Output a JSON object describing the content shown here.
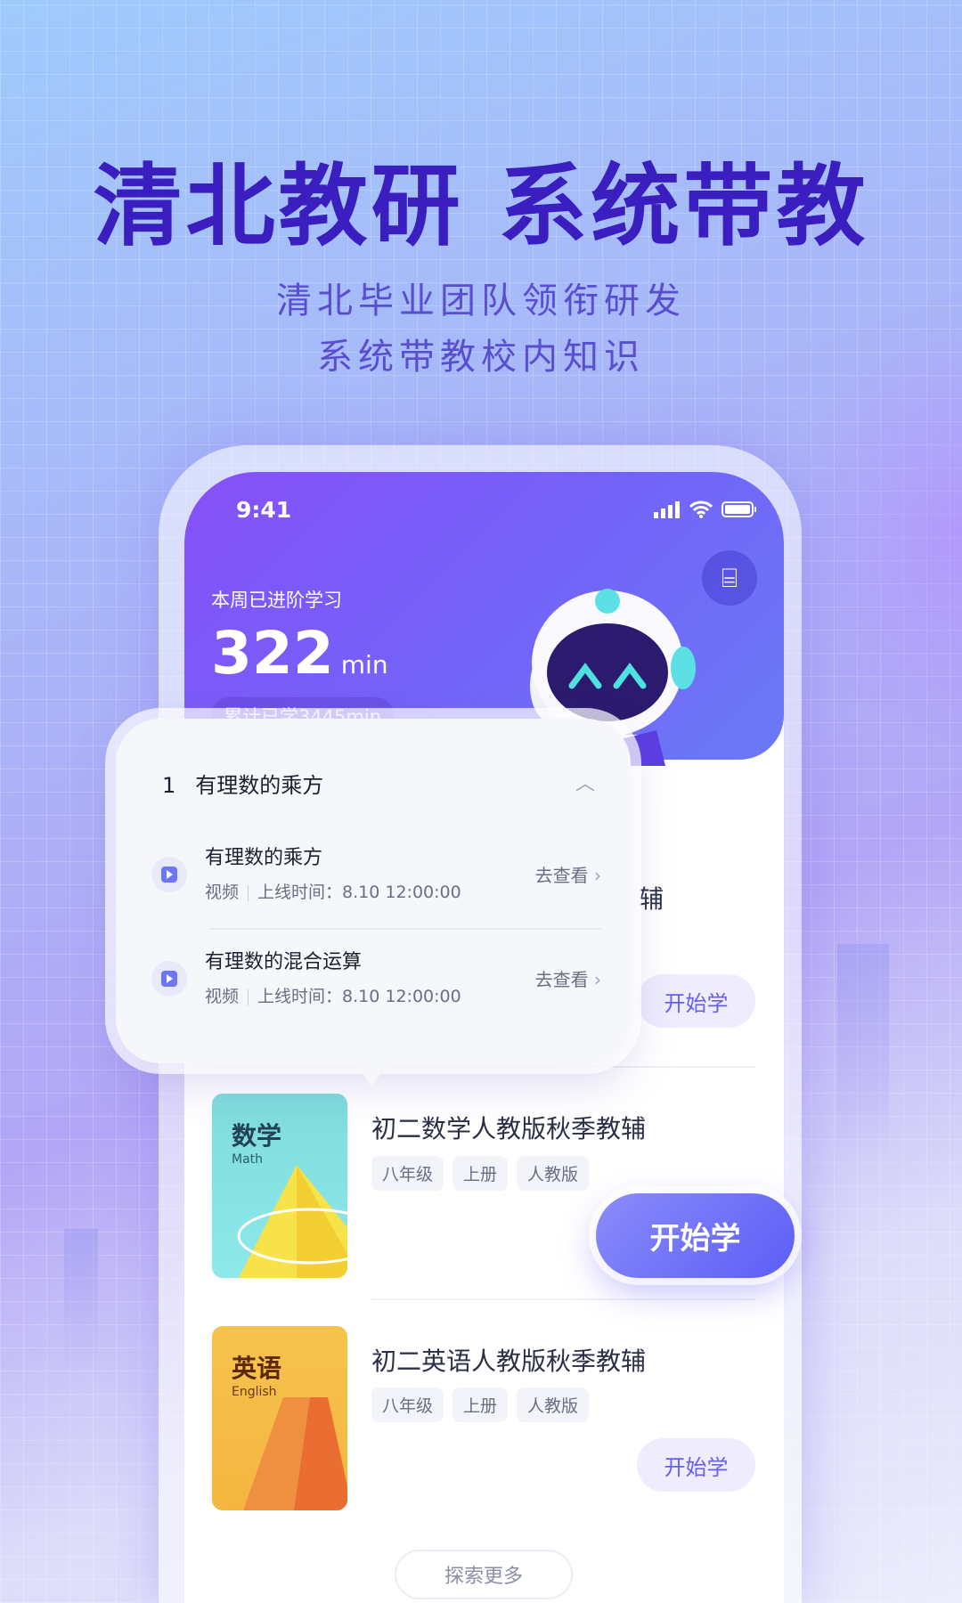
{
  "hero": {
    "title": "清北教研 系统带教",
    "subtitle_lines": [
      "清北毕业团队领衔研发",
      "系统带教校内知识"
    ]
  },
  "status_bar": {
    "time": "9:41",
    "icons": [
      "signal-icon",
      "wifi-icon",
      "battery-icon"
    ]
  },
  "header": {
    "week_label": "本周已进阶学习",
    "week_minutes": "322",
    "unit": "min",
    "total_label": "累计已学3445min",
    "scan_icon": "scan-icon"
  },
  "popup": {
    "chapter_number": "1",
    "chapter_title": "有理数的乘方",
    "items": [
      {
        "title": "有理数的乘方",
        "type": "视频",
        "online_time": "上线时间：8.10 12:00:00",
        "action": "去查看"
      },
      {
        "title": "有理数的混合运算",
        "type": "视频",
        "online_time": "上线时间：8.10 12:00:00",
        "action": "去查看"
      }
    ]
  },
  "courses": [
    {
      "title_visible": "辅",
      "button": "开始学"
    },
    {
      "cover_subject": "数学",
      "cover_en": "Math",
      "title": "初二数学人教版秋季教辅",
      "tags": [
        "八年级",
        "上册",
        "人教版"
      ],
      "button": "开始学"
    },
    {
      "cover_subject": "英语",
      "cover_en": "English",
      "title": "初二英语人教版秋季教辅",
      "tags": [
        "八年级",
        "上册",
        "人教版"
      ],
      "button": "开始学"
    }
  ],
  "explore_label": "探索更多",
  "colors": {
    "accent": "#5c5df6",
    "title": "#3a1ec0",
    "header_start": "#8650f8",
    "header_end": "#6a7af6"
  }
}
